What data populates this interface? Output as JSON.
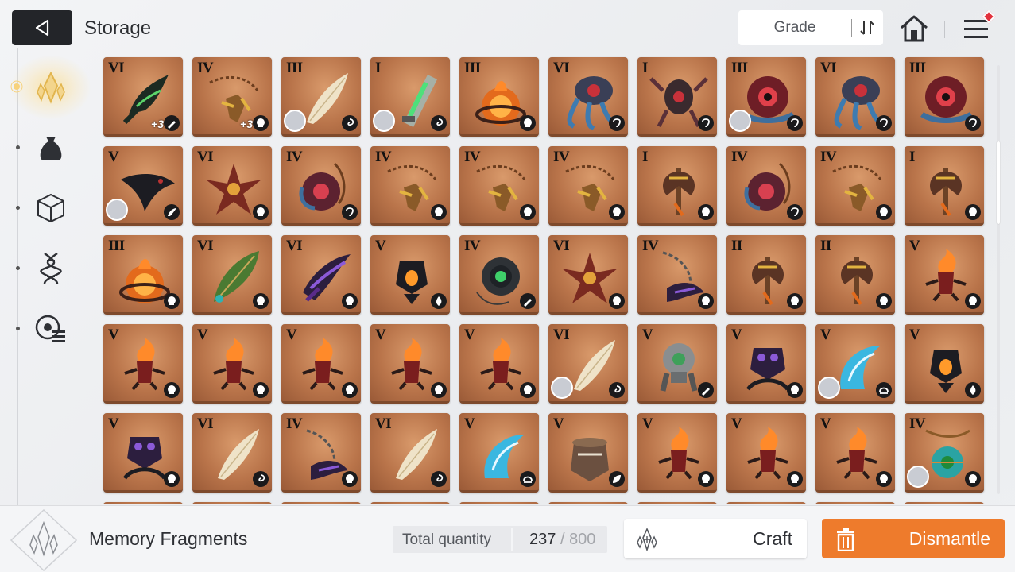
{
  "header": {
    "title": "Storage",
    "sort_label": "Grade"
  },
  "rail": {
    "items": [
      {
        "name": "memory-fragment",
        "selected": true
      },
      {
        "name": "bag"
      },
      {
        "name": "cube"
      },
      {
        "name": "dna"
      },
      {
        "name": "settings-list"
      }
    ]
  },
  "grid": {
    "rows": [
      [
        {
          "grade": "VI",
          "art": "claw-green",
          "elem": "pen",
          "plus": "+3"
        },
        {
          "grade": "IV",
          "art": "flail-gold",
          "elem": "skull",
          "plus": "+3"
        },
        {
          "grade": "III",
          "art": "feather-white",
          "elem": "swirl",
          "avatar": true
        },
        {
          "grade": "I",
          "art": "blade-green",
          "elem": "swirl",
          "avatar": true
        },
        {
          "grade": "III",
          "art": "orb-fire",
          "elem": "skull"
        },
        {
          "grade": "VI",
          "art": "squid-blue",
          "elem": "ram"
        },
        {
          "grade": "I",
          "art": "crab-red",
          "elem": "ram"
        },
        {
          "grade": "III",
          "art": "eye-red",
          "elem": "ram",
          "avatar": true
        },
        {
          "grade": "VI",
          "art": "squid-blue",
          "elem": "ram"
        },
        {
          "grade": "III",
          "art": "eye-red",
          "elem": "ram"
        }
      ],
      [
        {
          "grade": "V",
          "art": "crow-black",
          "elem": "wing",
          "avatar": true
        },
        {
          "grade": "VI",
          "art": "spike-red",
          "elem": "skull"
        },
        {
          "grade": "IV",
          "art": "eye-orb",
          "elem": "ram"
        },
        {
          "grade": "IV",
          "art": "flail-gold",
          "elem": "skull"
        },
        {
          "grade": "IV",
          "art": "flail-gold",
          "elem": "skull"
        },
        {
          "grade": "IV",
          "art": "flail-gold",
          "elem": "skull"
        },
        {
          "grade": "I",
          "art": "axe-gold",
          "elem": "skull"
        },
        {
          "grade": "IV",
          "art": "eye-orb",
          "elem": "ram"
        },
        {
          "grade": "IV",
          "art": "flail-gold",
          "elem": "skull"
        },
        {
          "grade": "I",
          "art": "axe-gold",
          "elem": "skull"
        }
      ],
      [
        {
          "grade": "III",
          "art": "orb-fire",
          "elem": "skull"
        },
        {
          "grade": "VI",
          "art": "leaf-green",
          "elem": "skull"
        },
        {
          "grade": "VI",
          "art": "claw-purple",
          "elem": "skull"
        },
        {
          "grade": "V",
          "art": "lantern-black",
          "elem": "flame"
        },
        {
          "grade": "IV",
          "art": "ring-green",
          "elem": "pen"
        },
        {
          "grade": "VI",
          "art": "spike-red",
          "elem": "skull"
        },
        {
          "grade": "IV",
          "art": "chain-purple",
          "elem": "skull"
        },
        {
          "grade": "II",
          "art": "axe-gold",
          "elem": "skull"
        },
        {
          "grade": "II",
          "art": "axe-gold",
          "elem": "skull"
        },
        {
          "grade": "V",
          "art": "brazier-fire",
          "elem": "skull"
        }
      ],
      [
        {
          "grade": "V",
          "art": "brazier-fire",
          "elem": "skull"
        },
        {
          "grade": "V",
          "art": "brazier-fire",
          "elem": "skull"
        },
        {
          "grade": "V",
          "art": "brazier-fire",
          "elem": "skull"
        },
        {
          "grade": "V",
          "art": "brazier-fire",
          "elem": "skull"
        },
        {
          "grade": "V",
          "art": "brazier-fire",
          "elem": "skull"
        },
        {
          "grade": "VI",
          "art": "feather-white",
          "elem": "swirl",
          "avatar": true
        },
        {
          "grade": "V",
          "art": "robot-gray",
          "elem": "pen"
        },
        {
          "grade": "V",
          "art": "lantern-purple",
          "elem": "skull"
        },
        {
          "grade": "V",
          "art": "wave-blue",
          "elem": "balance",
          "avatar": true
        },
        {
          "grade": "V",
          "art": "lantern-black",
          "elem": "flame"
        }
      ],
      [
        {
          "grade": "V",
          "art": "lantern-purple",
          "elem": "skull"
        },
        {
          "grade": "VI",
          "art": "feather-white",
          "elem": "swirl"
        },
        {
          "grade": "IV",
          "art": "chain-purple",
          "elem": "skull"
        },
        {
          "grade": "VI",
          "art": "feather-white",
          "elem": "swirl"
        },
        {
          "grade": "V",
          "art": "wave-blue",
          "elem": "balance"
        },
        {
          "grade": "V",
          "art": "urn-brown",
          "elem": "leaf"
        },
        {
          "grade": "V",
          "art": "brazier-fire",
          "elem": "skull"
        },
        {
          "grade": "V",
          "art": "brazier-fire",
          "elem": "skull"
        },
        {
          "grade": "V",
          "art": "brazier-fire",
          "elem": "skull"
        },
        {
          "grade": "IV",
          "art": "amulet-teal",
          "elem": "skull",
          "avatar": true
        }
      ]
    ]
  },
  "footer": {
    "item_name": "Memory Fragments",
    "total_label": "Total quantity",
    "quantity": "237",
    "slash": "/",
    "capacity": "800",
    "craft_label": "Craft",
    "dismantle_label": "Dismantle"
  },
  "colors": {
    "accent": "#ee7b2c",
    "card": "#b9744a",
    "back_button": "#232529",
    "badge": "#e2313c"
  }
}
